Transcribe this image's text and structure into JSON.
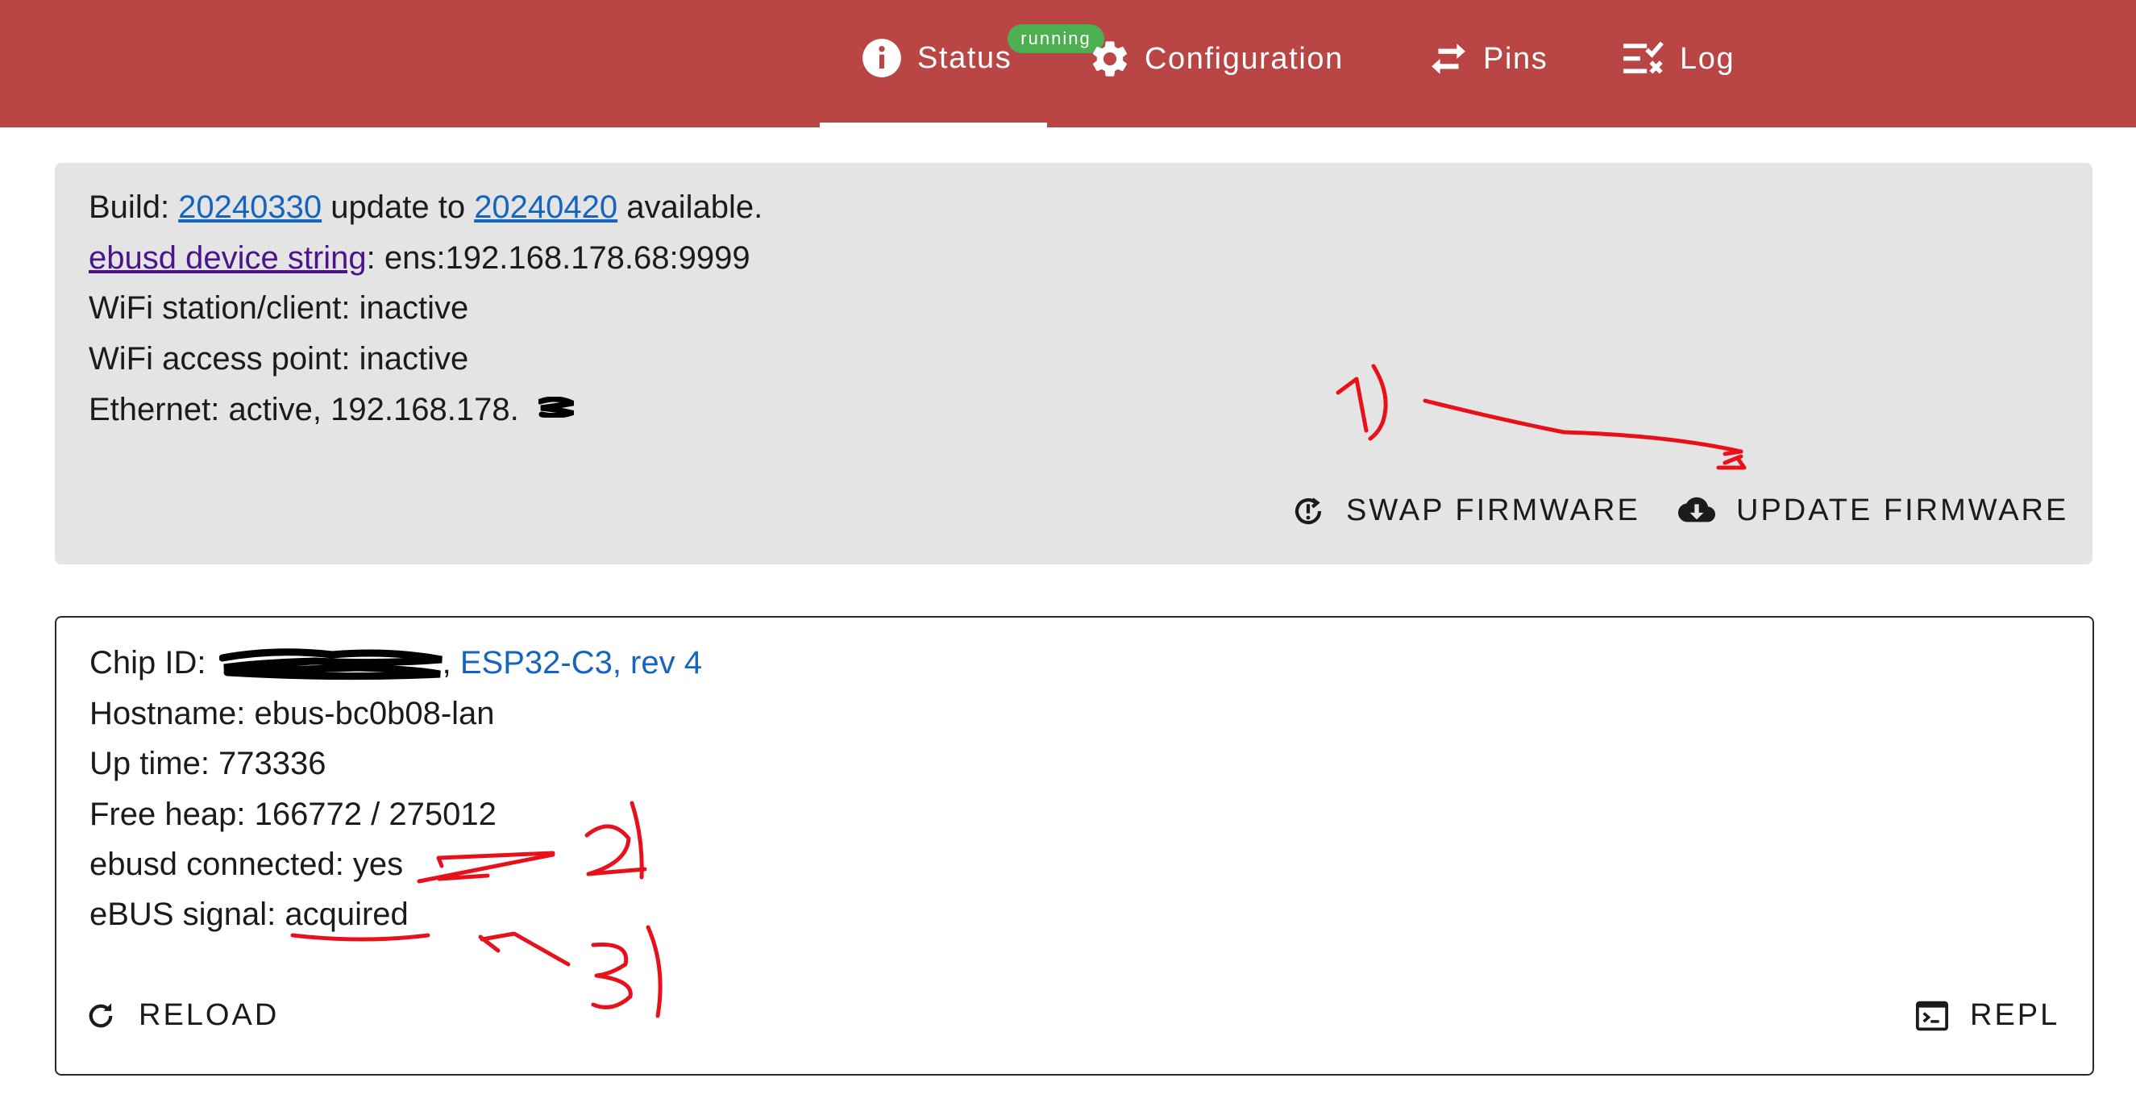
{
  "colors": {
    "header_bg": "#b94545",
    "badge_bg": "#4caf50",
    "link": "#1565c0",
    "visited_link": "#4a148c",
    "firmware_card_bg": "#e4e4e4",
    "annotation": "#e8111b"
  },
  "nav": {
    "tabs": [
      {
        "label": "Status",
        "icon": "info-icon",
        "active": true
      },
      {
        "label": "Configuration",
        "icon": "gear-icon",
        "active": false
      },
      {
        "label": "Pins",
        "icon": "swap-arrows-icon",
        "active": false
      },
      {
        "label": "Log",
        "icon": "checklist-icon",
        "active": false
      }
    ],
    "badge": "running"
  },
  "firmware": {
    "build_label": "Build: ",
    "build_version": "20240330",
    "update_text": " update to ",
    "update_version": "20240420",
    "available_text": " available.",
    "device_string_link": "ebusd device string",
    "device_string_value": ": ens:192.168.178.68:9999",
    "wifi_client": "WiFi station/client: inactive",
    "wifi_ap": "WiFi access point: inactive",
    "ethernet": "Ethernet: active, 192.168.178.",
    "swap_button": "SWAP FIRMWARE",
    "update_button": "UPDATE FIRMWARE"
  },
  "device": {
    "chip_label": "Chip ID: ",
    "chip_comma": ",",
    "chip_model": " ESP32-C3, rev 4",
    "hostname": "Hostname: ebus-bc0b08-lan",
    "uptime": "Up time: 773336",
    "free_heap": "Free heap: 166772 / 275012",
    "ebusd_label": "ebusd connected: ",
    "ebusd_value": "yes",
    "signal_label": "eBUS signal: ",
    "signal_value": "acquired",
    "reload_button": "RELOAD",
    "repl_button": "REPL"
  }
}
